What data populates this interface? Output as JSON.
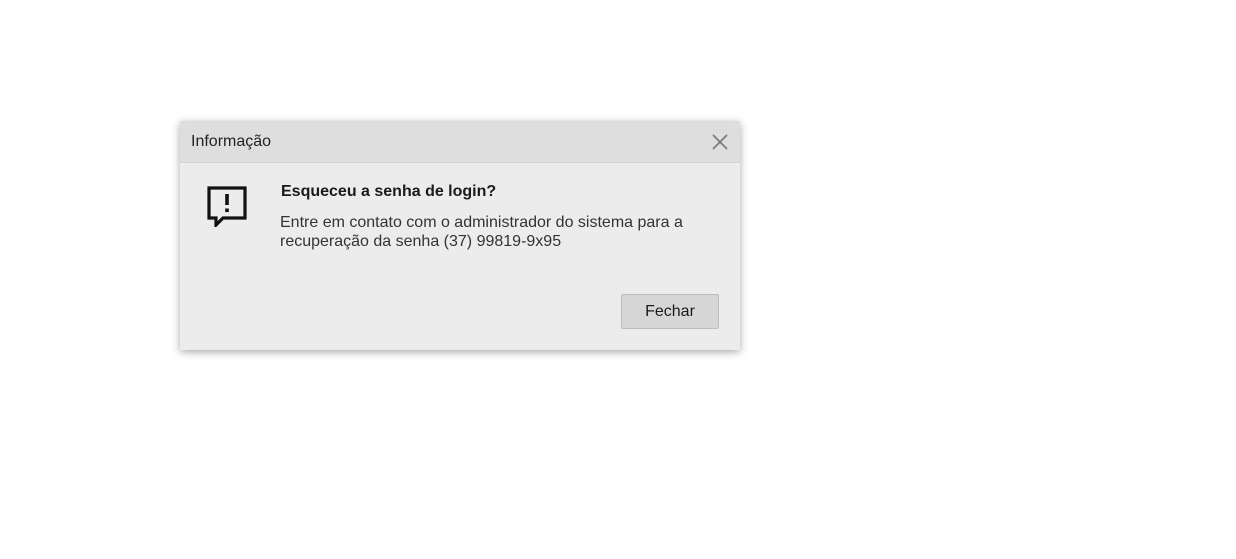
{
  "dialog": {
    "title": "Informação",
    "close_icon": "close-icon",
    "message_icon": "chat-alert-icon",
    "heading": "Esqueceu a senha de login?",
    "message": "Entre em contato com o administrador do sistema para a recuperação da senha (37) 99819-9x95",
    "close_button_label": "Fechar"
  }
}
